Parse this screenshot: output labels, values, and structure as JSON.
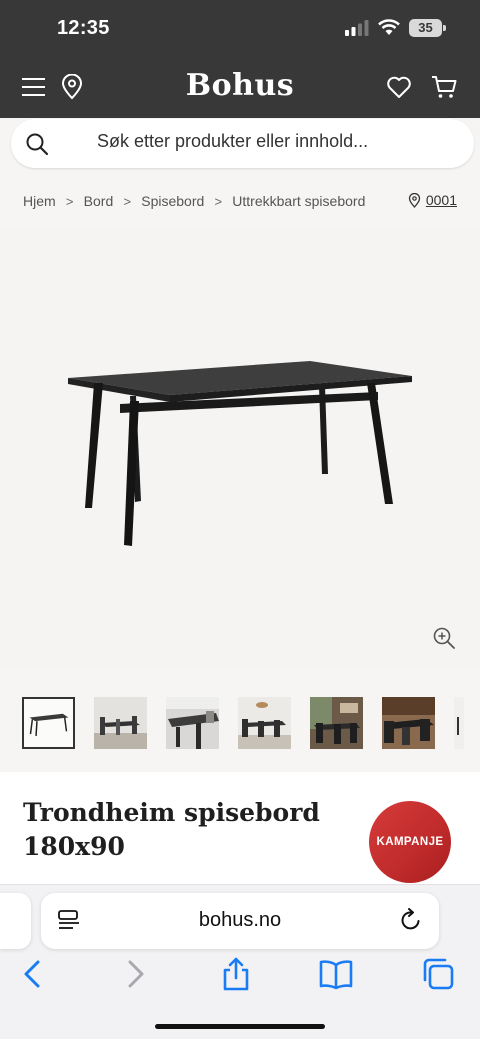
{
  "status_bar": {
    "time": "12:35",
    "battery": "35"
  },
  "header": {
    "brand": "Bohus",
    "bg_color": "#383838"
  },
  "search": {
    "placeholder": "Søk etter produkter eller innhold..."
  },
  "breadcrumb": {
    "items": [
      "Hjem",
      "Bord",
      "Spisebord",
      "Uttrekkbart spisebord"
    ],
    "store_code": "0001"
  },
  "product": {
    "title": "Trondheim spisebord 180x90",
    "badge": "KAMPANJE",
    "badge_color": "#c8302f"
  },
  "gallery": {
    "thumbnail_count": 7,
    "active_index": 0
  },
  "browser": {
    "url": "bohus.no"
  },
  "icons": [
    "menu-icon",
    "location-pin-icon",
    "heart-icon",
    "cart-icon",
    "search-icon",
    "zoom-in-icon",
    "page-menu-icon",
    "reload-icon",
    "back-icon",
    "forward-icon",
    "share-icon",
    "bookmarks-icon",
    "tabs-icon"
  ]
}
